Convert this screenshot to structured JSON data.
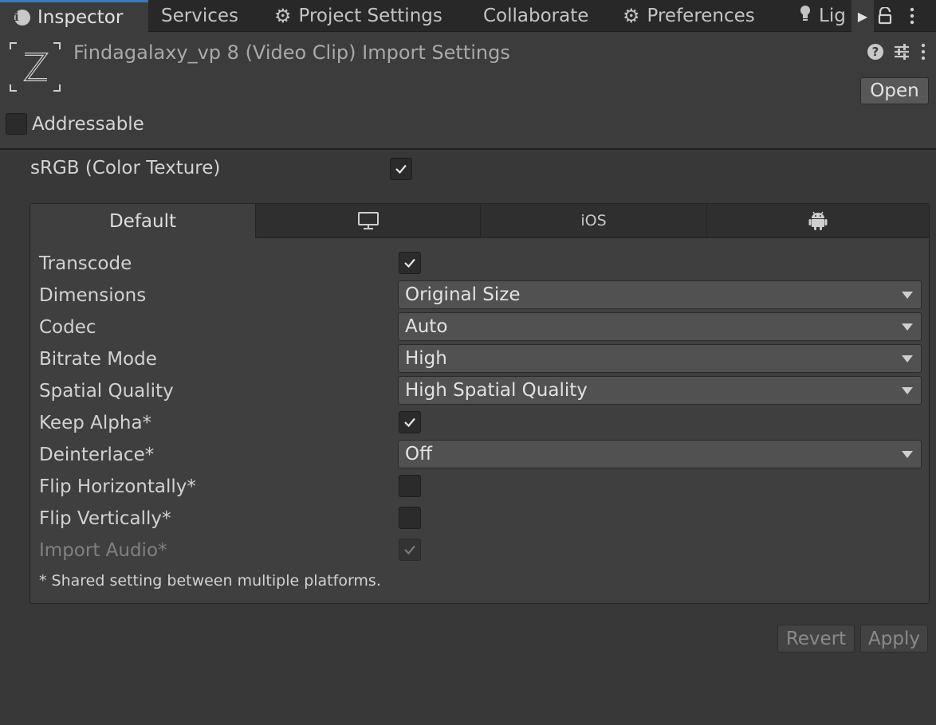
{
  "tabs": [
    {
      "label": "Inspector",
      "icon": "info-icon"
    },
    {
      "label": "Services",
      "icon": ""
    },
    {
      "label": "Project Settings",
      "icon": "gear-icon"
    },
    {
      "label": "Collaborate",
      "icon": ""
    },
    {
      "label": "Preferences",
      "icon": "gear-icon"
    },
    {
      "label": "Lig",
      "icon": "lightbulb-icon"
    }
  ],
  "header": {
    "title": "Findagalaxy_vp 8 (Video Clip) Import Settings",
    "open_label": "Open",
    "addressable_label": "Addressable",
    "addressable_checked": false
  },
  "srgb": {
    "label": "sRGB (Color Texture)",
    "checked": true
  },
  "platform_tabs": [
    {
      "label": "Default",
      "icon": ""
    },
    {
      "label": "",
      "icon": "monitor-icon"
    },
    {
      "label": "iOS",
      "icon": ""
    },
    {
      "label": "",
      "icon": "android-icon"
    }
  ],
  "settings": {
    "transcode": {
      "label": "Transcode",
      "checked": true
    },
    "dimensions": {
      "label": "Dimensions",
      "value": "Original Size"
    },
    "codec": {
      "label": "Codec",
      "value": "Auto"
    },
    "bitrate_mode": {
      "label": "Bitrate Mode",
      "value": "High"
    },
    "spatial_quality": {
      "label": "Spatial Quality",
      "value": "High Spatial Quality"
    },
    "keep_alpha": {
      "label": "Keep Alpha*",
      "checked": true
    },
    "deinterlace": {
      "label": "Deinterlace*",
      "value": "Off"
    },
    "flip_horizontally": {
      "label": "Flip Horizontally*",
      "checked": false
    },
    "flip_vertically": {
      "label": "Flip Vertically*",
      "checked": false
    },
    "import_audio": {
      "label": "Import Audio*",
      "checked": true,
      "disabled": true
    }
  },
  "footnote": "* Shared setting between multiple platforms.",
  "buttons": {
    "revert": "Revert",
    "apply": "Apply"
  },
  "colors": {
    "background": "#383838",
    "tabbar": "#282828",
    "active_tab_accent": "#3a79bb"
  }
}
